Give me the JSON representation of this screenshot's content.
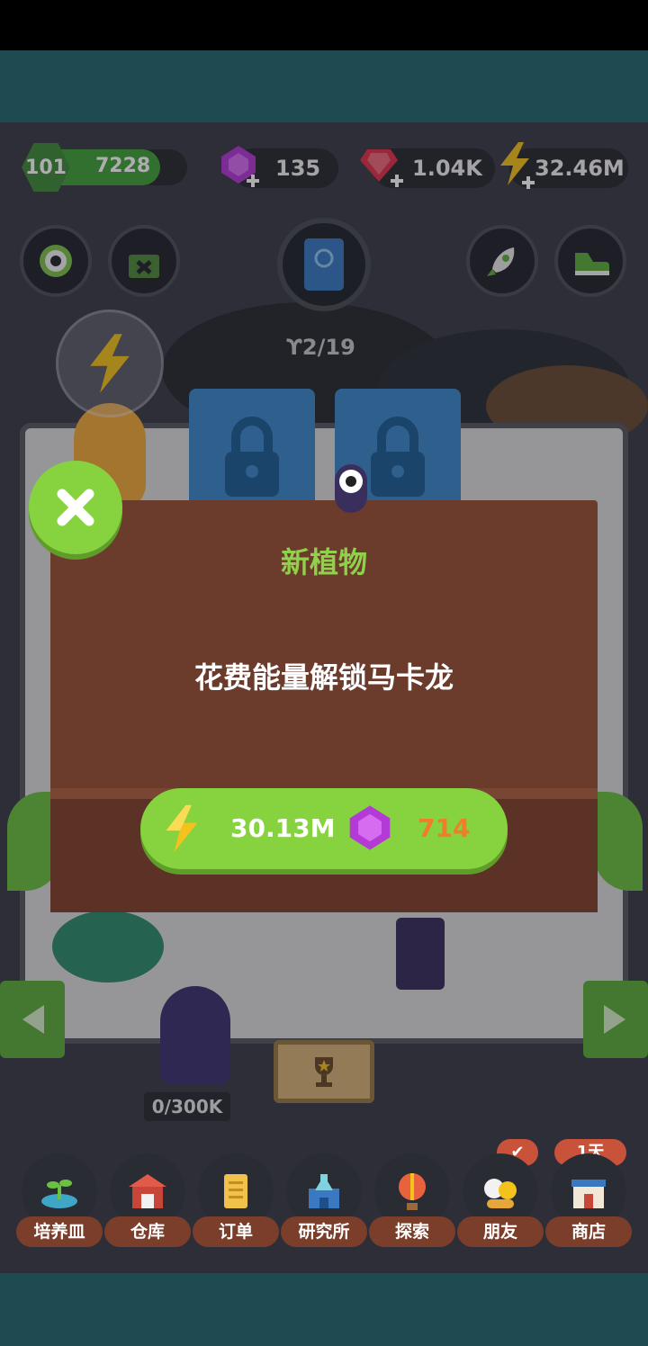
{
  "resources": {
    "level": "101",
    "xp": "7228",
    "xp_fraction": 0.82,
    "gems": "135",
    "rubies": "1.04K",
    "energy": "32.46M"
  },
  "book": {
    "progress": "2/19"
  },
  "storage": {
    "capacity": "0/300K"
  },
  "dialog": {
    "title": "新植物",
    "message": "花费能量解锁马卡龙",
    "energy_cost": "30.13M",
    "gem_cost": "714"
  },
  "nav": {
    "items": [
      {
        "label": "培养皿",
        "icon": "seedling-icon"
      },
      {
        "label": "仓库",
        "icon": "barn-icon"
      },
      {
        "label": "订单",
        "icon": "scroll-icon"
      },
      {
        "label": "研究所",
        "icon": "lab-icon"
      },
      {
        "label": "探索",
        "icon": "balloon-icon"
      },
      {
        "label": "朋友",
        "icon": "friends-icon"
      },
      {
        "label": "商店",
        "icon": "shop-icon"
      }
    ],
    "shop_badge": "1天"
  },
  "colors": {
    "accent_green": "#86d33f",
    "dialog_brown": "#6b3b2c",
    "gem_purple": "#b43ad6",
    "ruby_red": "#e2324a",
    "energy_yellow": "#f4c21d",
    "gem_cost_orange": "#f07d2a"
  }
}
